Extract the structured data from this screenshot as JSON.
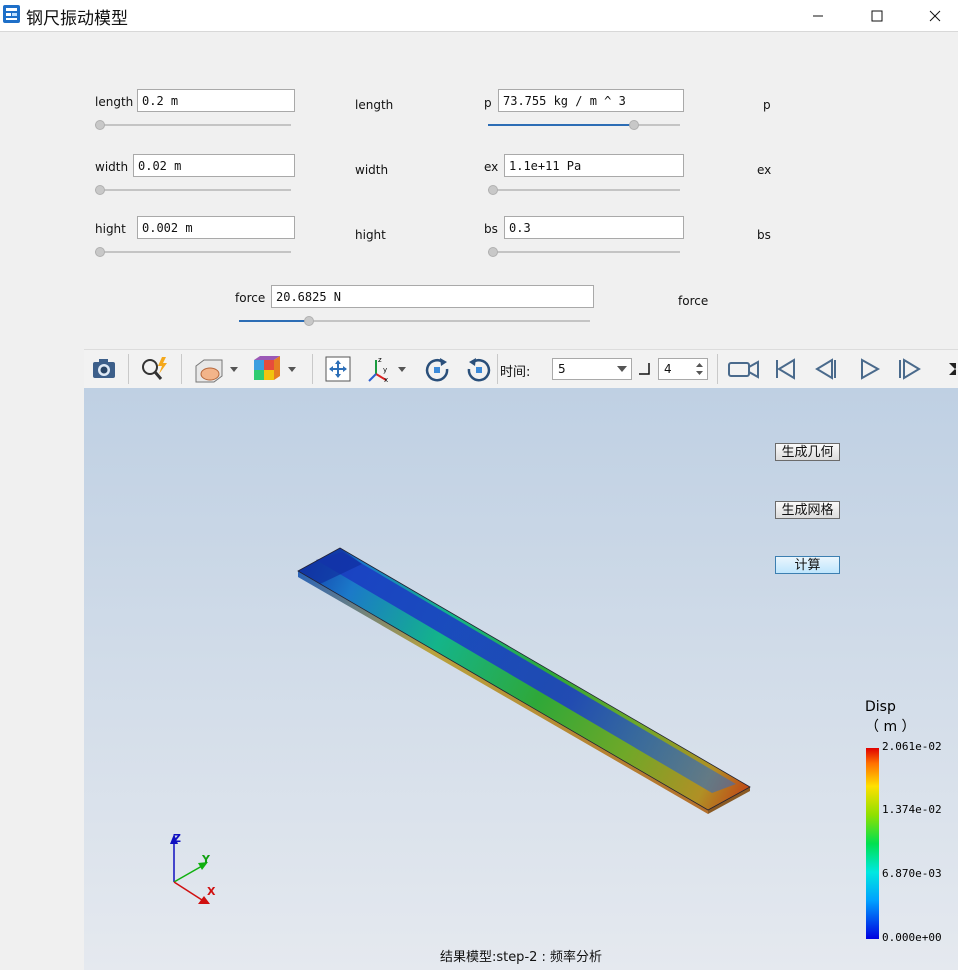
{
  "window": {
    "title": "钢尺振动模型"
  },
  "params": {
    "length": {
      "label": "length",
      "value": "0.2 m",
      "side_label": "length",
      "slider": 0.0
    },
    "width": {
      "label": "width",
      "value": "0.02 m",
      "side_label": "width",
      "slider": 0.0
    },
    "hight": {
      "label": "hight",
      "value": "0.002 m",
      "side_label": "hight",
      "slider": 0.0
    },
    "p": {
      "label": "p",
      "value": "73.755 kg / m ^ 3",
      "side_label": "p",
      "slider": 0.76
    },
    "ex": {
      "label": "ex",
      "value": "1.1e+11 Pa",
      "side_label": "ex",
      "slider": 0.0
    },
    "bs": {
      "label": "bs",
      "value": "0.3",
      "side_label": "bs",
      "slider": 0.0
    },
    "force": {
      "label": "force",
      "value": "20.6825 N",
      "side_label": "force",
      "slider": 0.2
    }
  },
  "toolbar": {
    "time_label": "时间:",
    "time_value": "5",
    "step_value": "4",
    "icons": [
      "camera-icon",
      "search-flash-icon",
      "view-box-icon",
      "mesh-cube-icon",
      "fit-view-icon",
      "axis-icon",
      "rotate-left-icon",
      "rotate-right-icon",
      "video-camera-icon",
      "skip-first-icon",
      "step-back-icon",
      "play-icon",
      "step-forward-icon",
      "fullscreen-icon"
    ]
  },
  "viewport": {
    "buttons": {
      "generate_geometry": "生成几何",
      "generate_mesh": "生成网格",
      "compute": "计算"
    },
    "legend": {
      "title": "Disp",
      "unit": "（ m ）",
      "max": "2.061e-02",
      "v2": "1.374e-02",
      "v1": "6.870e-03",
      "min": "0.000e+00"
    },
    "axes": {
      "x": "X",
      "y": "Y",
      "z": "Z"
    },
    "status": "结果模型:step-2 : 频率分析"
  },
  "colors": {
    "accent": "#2c6db5",
    "viewport_top": "#bfd0e3",
    "viewport_bottom": "#e5e9ef"
  }
}
